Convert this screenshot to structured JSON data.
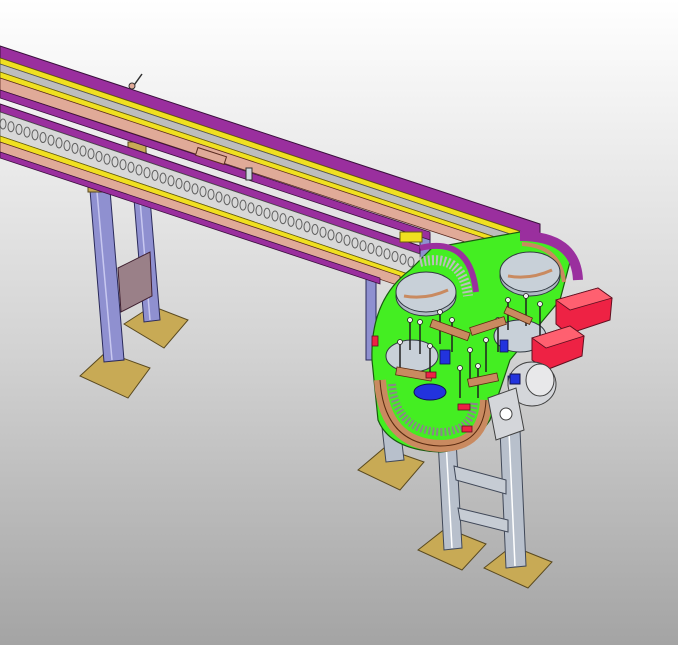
{
  "scene": {
    "subject": "conveyor-assembly",
    "colors": {
      "background_top": "#ffffff",
      "background_bottom": "#a4a4a4",
      "rail_purple": "#9a2f9e",
      "rail_yellow": "#f0e020",
      "rail_salmon": "#e0aa98",
      "chain_plate": "#bdbdbd",
      "leg_blue": "#8f90d0",
      "base_gold": "#c8aa55",
      "frame_grey": "#b8c0cc",
      "turntable_green": "#44ee22",
      "guide_copper": "#c98a60",
      "motor_red": "#ee2244",
      "motor_grey": "#d4d6da",
      "disc_grey": "#b0bac4",
      "accent_blue": "#2233dd"
    },
    "icons": [
      "conveyor-icon",
      "turntable-icon",
      "drive-motor-icon",
      "support-leg-icon"
    ]
  }
}
